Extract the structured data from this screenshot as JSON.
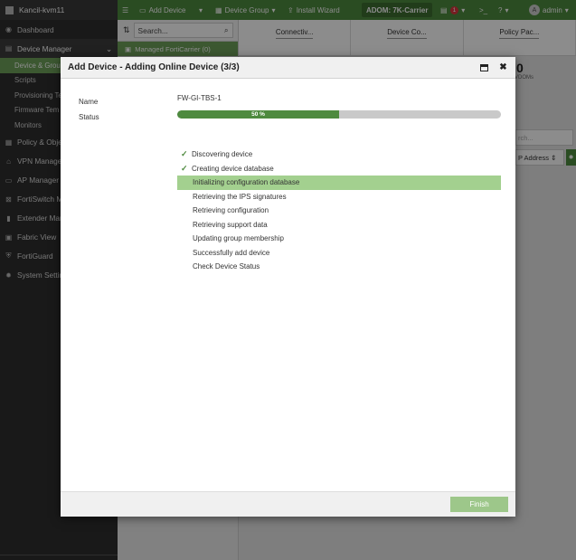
{
  "sidebar": {
    "brand": "Kancil-kvm11",
    "items": [
      {
        "label": "Dashboard",
        "icon": "dashboard-icon"
      },
      {
        "label": "Device Manager",
        "icon": "device-manager-icon"
      },
      {
        "label": "Policy & Obje",
        "icon": "policy-icon"
      },
      {
        "label": "VPN Manager",
        "icon": "vpn-icon"
      },
      {
        "label": "AP Manager",
        "icon": "ap-icon"
      },
      {
        "label": "FortiSwitch M",
        "icon": "switch-icon"
      },
      {
        "label": "Extender Mar",
        "icon": "extender-icon"
      },
      {
        "label": "Fabric View",
        "icon": "fabric-icon"
      },
      {
        "label": "FortiGuard",
        "icon": "fortiguard-icon"
      },
      {
        "label": "System Settin",
        "icon": "settings-icon"
      }
    ],
    "subitems": [
      "Device & Grou",
      "Scripts",
      "Provisioning Te",
      "Firmware Tem",
      "Monitors"
    ]
  },
  "topbar": {
    "add_device": "Add Device",
    "device_group": "Device Group",
    "install_wizard": "Install Wizard",
    "adom": "ADOM: 7K-Carrier",
    "notif_count": "1",
    "user": "admin"
  },
  "tree": {
    "search_placeholder": "Search...",
    "managed": "Managed FortiCarrier (0)"
  },
  "main": {
    "tabs": [
      "Connectiv...",
      "Device Co...",
      "Policy Pac..."
    ],
    "stat_value": "0",
    "stat_label": "VDOMs",
    "search_placeholder": "rch...",
    "ip_header": "P Address"
  },
  "modal": {
    "title": "Add Device - Adding Online Device (3/3)",
    "name_label": "Name",
    "name_value": "FW-GI-TBS-1",
    "status_label": "Status",
    "progress": 50,
    "progress_text": "50 %",
    "steps": [
      {
        "label": "Discovering device",
        "state": "done"
      },
      {
        "label": "Creating device database",
        "state": "done"
      },
      {
        "label": "Initializing configuration database",
        "state": "current"
      },
      {
        "label": "Retrieving the IPS signatures",
        "state": "pending"
      },
      {
        "label": "Retrieving configuration",
        "state": "pending"
      },
      {
        "label": "Retrieving support data",
        "state": "pending"
      },
      {
        "label": "Updating group membership",
        "state": "pending"
      },
      {
        "label": "Successfully add device",
        "state": "pending"
      },
      {
        "label": "Check Device Status",
        "state": "pending"
      }
    ],
    "finish_label": "Finish"
  },
  "colors": {
    "brand_green": "#4e8a3f",
    "highlight": "#a3d08f",
    "sidebar_bg": "#2e2e2e"
  }
}
